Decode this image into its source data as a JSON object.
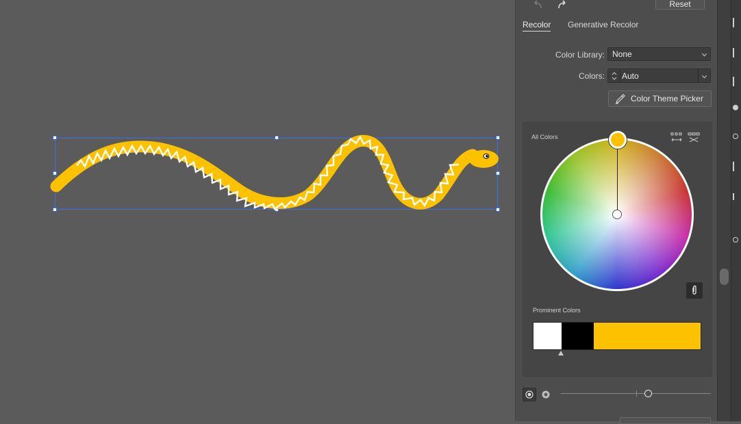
{
  "toolbar": {
    "undo_icon": "undo-icon",
    "redo_icon": "redo-icon",
    "reset_label": "Reset"
  },
  "tabs": [
    {
      "label": "Recolor",
      "active": true
    },
    {
      "label": "Generative Recolor",
      "active": false
    }
  ],
  "color_library": {
    "label": "Color Library:",
    "value": "None"
  },
  "colors": {
    "label": "Colors:",
    "value": "Auto"
  },
  "theme_picker": {
    "label": "Color Theme Picker",
    "icon": "eyedropper-icon"
  },
  "wheel": {
    "title": "All Colors",
    "base_color": "#fcc200",
    "link_icon": "link-icon"
  },
  "prominent": {
    "title": "Prominent Colors",
    "swatches": [
      {
        "color": "#ffffff",
        "share": 0.17
      },
      {
        "color": "#000000",
        "share": 0.19
      },
      {
        "color": "#fcc200",
        "share": 0.64
      }
    ]
  },
  "colors_ui": {
    "snake_fill": "#fcc200",
    "selection": "#3b6ff0"
  }
}
